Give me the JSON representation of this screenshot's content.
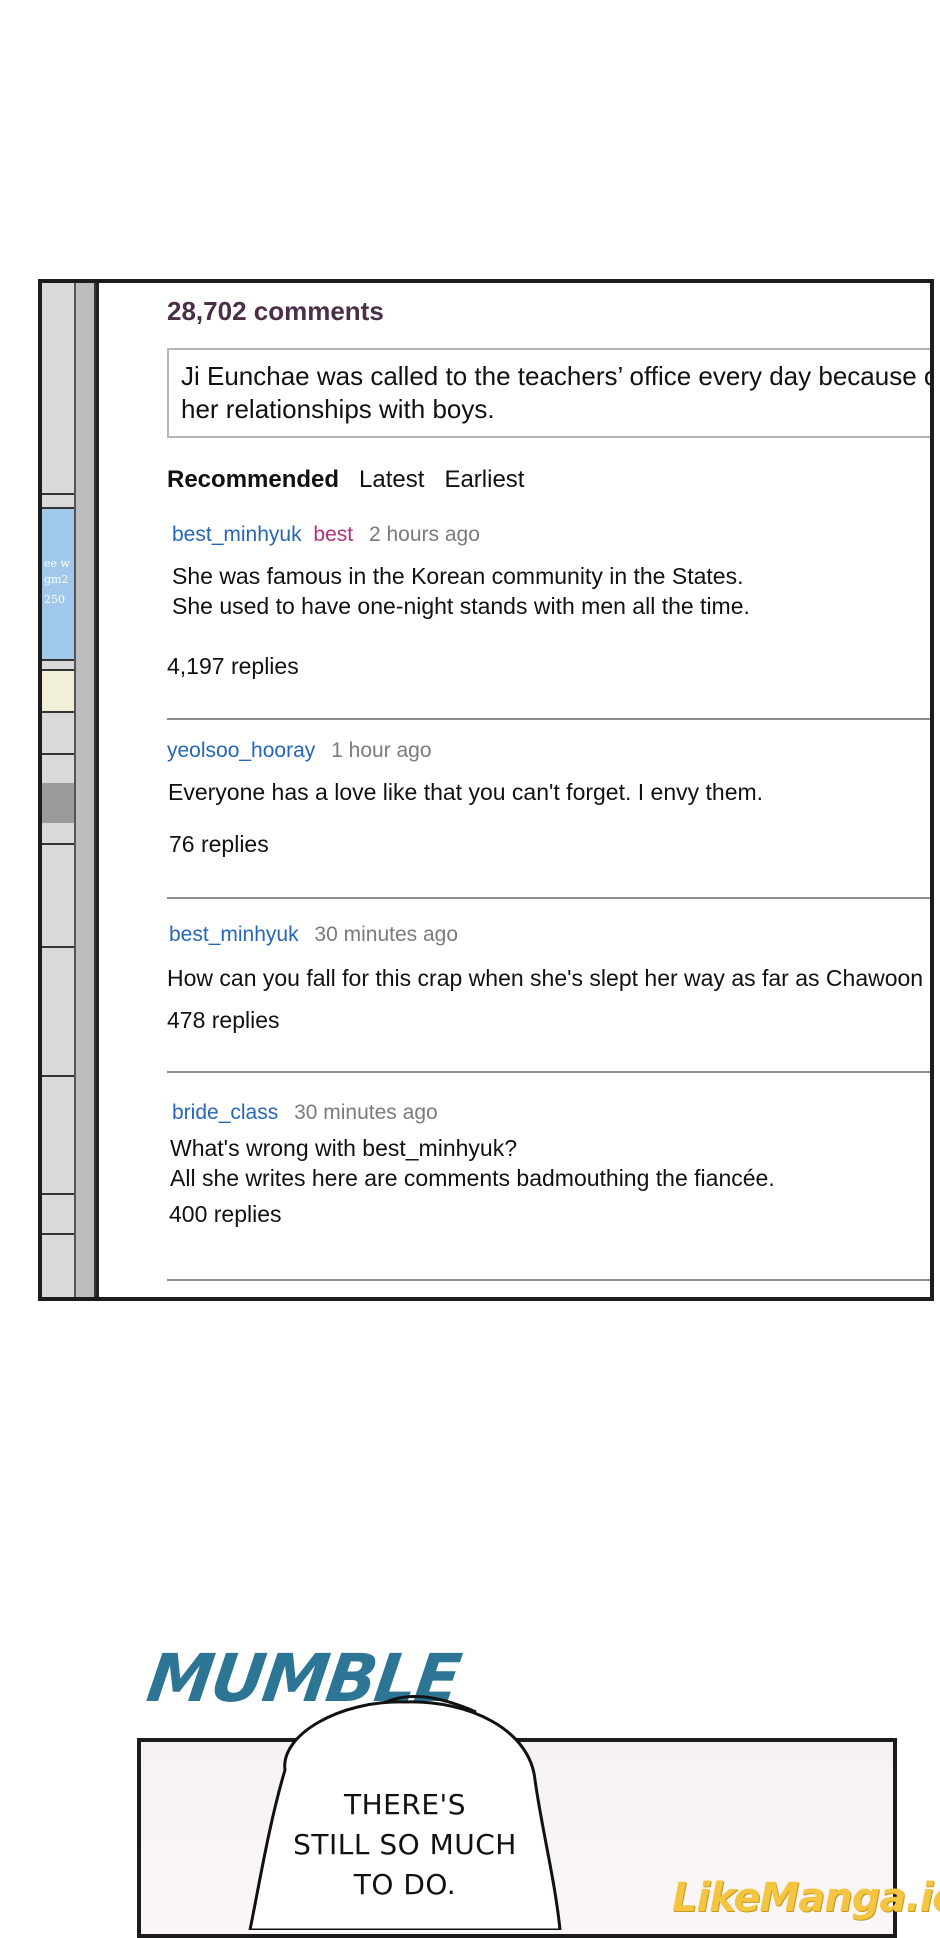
{
  "comments_header": {
    "count_label": "28,702 comments"
  },
  "post": {
    "text": "Ji Eunchae was called to the teachers’ office every day because of her relationships with boys."
  },
  "sort_tabs": [
    "Recommended",
    "Latest",
    "Earliest"
  ],
  "comments": [
    {
      "username": "best_minhyuk",
      "badge": "best",
      "time": "2 hours ago",
      "lines": [
        "She was famous in the Korean community in the States.",
        "She used to have one-night stands with men all the time."
      ],
      "replies": "4,197 replies"
    },
    {
      "username": "yeolsoo_hooray",
      "time": "1 hour ago",
      "lines": [
        "Everyone has a love like that you can't forget. I envy them."
      ],
      "replies": "76 replies"
    },
    {
      "username": "best_minhyuk",
      "time": "30 minutes ago",
      "lines": [
        "How can you fall for this crap when she's slept her way as far as Chawoon"
      ],
      "replies": "478 replies"
    },
    {
      "username": "bride_class",
      "time": "30 minutes ago",
      "lines": [
        "What's wrong with best_minhyuk?",
        "All she writes here are comments badmouthing the fiancée."
      ],
      "replies": "400 replies"
    }
  ],
  "comic": {
    "sound_effect": "MUMBLE",
    "speech_lines": [
      "THERE'S",
      "STILL SO MUCH",
      "TO DO."
    ],
    "watermark": "LikeManga.io"
  },
  "colors": {
    "username": "#2566b8",
    "best_badge": "#b0307e",
    "timestamp": "#7b7b7b",
    "count_label": "#4a2f46",
    "sound_effect": "#2c7595",
    "watermark": "#f4c542"
  }
}
